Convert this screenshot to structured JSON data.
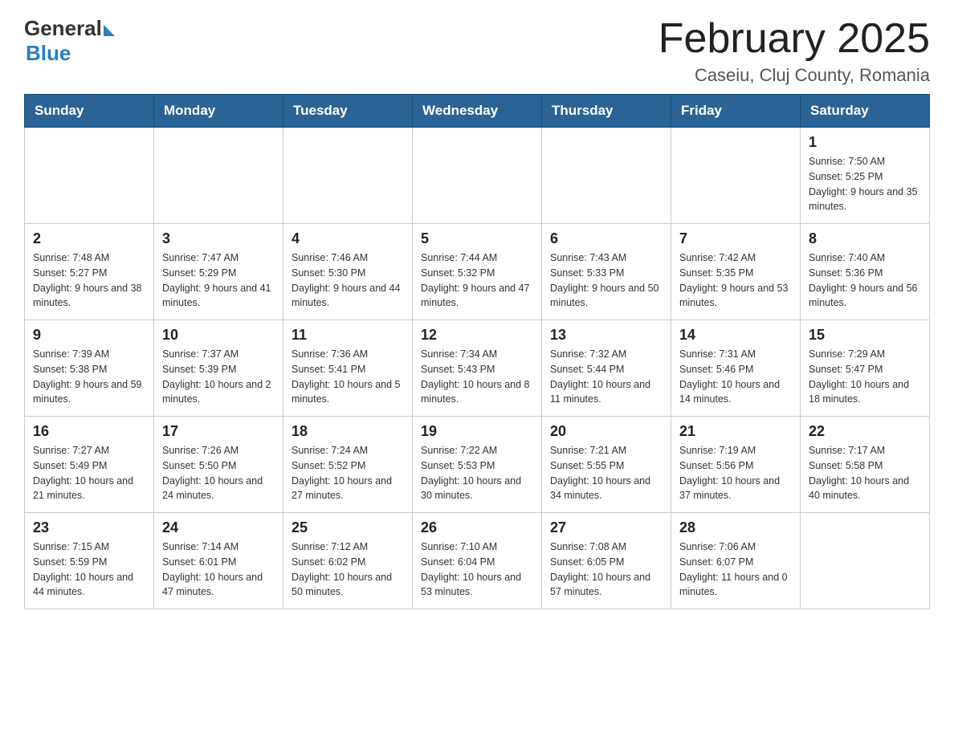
{
  "logo": {
    "general": "General",
    "blue": "Blue"
  },
  "header": {
    "title": "February 2025",
    "location": "Caseiu, Cluj County, Romania"
  },
  "days_of_week": [
    "Sunday",
    "Monday",
    "Tuesday",
    "Wednesday",
    "Thursday",
    "Friday",
    "Saturday"
  ],
  "weeks": [
    [
      {
        "day": "",
        "info": ""
      },
      {
        "day": "",
        "info": ""
      },
      {
        "day": "",
        "info": ""
      },
      {
        "day": "",
        "info": ""
      },
      {
        "day": "",
        "info": ""
      },
      {
        "day": "",
        "info": ""
      },
      {
        "day": "1",
        "info": "Sunrise: 7:50 AM\nSunset: 5:25 PM\nDaylight: 9 hours and 35 minutes."
      }
    ],
    [
      {
        "day": "2",
        "info": "Sunrise: 7:48 AM\nSunset: 5:27 PM\nDaylight: 9 hours and 38 minutes."
      },
      {
        "day": "3",
        "info": "Sunrise: 7:47 AM\nSunset: 5:29 PM\nDaylight: 9 hours and 41 minutes."
      },
      {
        "day": "4",
        "info": "Sunrise: 7:46 AM\nSunset: 5:30 PM\nDaylight: 9 hours and 44 minutes."
      },
      {
        "day": "5",
        "info": "Sunrise: 7:44 AM\nSunset: 5:32 PM\nDaylight: 9 hours and 47 minutes."
      },
      {
        "day": "6",
        "info": "Sunrise: 7:43 AM\nSunset: 5:33 PM\nDaylight: 9 hours and 50 minutes."
      },
      {
        "day": "7",
        "info": "Sunrise: 7:42 AM\nSunset: 5:35 PM\nDaylight: 9 hours and 53 minutes."
      },
      {
        "day": "8",
        "info": "Sunrise: 7:40 AM\nSunset: 5:36 PM\nDaylight: 9 hours and 56 minutes."
      }
    ],
    [
      {
        "day": "9",
        "info": "Sunrise: 7:39 AM\nSunset: 5:38 PM\nDaylight: 9 hours and 59 minutes."
      },
      {
        "day": "10",
        "info": "Sunrise: 7:37 AM\nSunset: 5:39 PM\nDaylight: 10 hours and 2 minutes."
      },
      {
        "day": "11",
        "info": "Sunrise: 7:36 AM\nSunset: 5:41 PM\nDaylight: 10 hours and 5 minutes."
      },
      {
        "day": "12",
        "info": "Sunrise: 7:34 AM\nSunset: 5:43 PM\nDaylight: 10 hours and 8 minutes."
      },
      {
        "day": "13",
        "info": "Sunrise: 7:32 AM\nSunset: 5:44 PM\nDaylight: 10 hours and 11 minutes."
      },
      {
        "day": "14",
        "info": "Sunrise: 7:31 AM\nSunset: 5:46 PM\nDaylight: 10 hours and 14 minutes."
      },
      {
        "day": "15",
        "info": "Sunrise: 7:29 AM\nSunset: 5:47 PM\nDaylight: 10 hours and 18 minutes."
      }
    ],
    [
      {
        "day": "16",
        "info": "Sunrise: 7:27 AM\nSunset: 5:49 PM\nDaylight: 10 hours and 21 minutes."
      },
      {
        "day": "17",
        "info": "Sunrise: 7:26 AM\nSunset: 5:50 PM\nDaylight: 10 hours and 24 minutes."
      },
      {
        "day": "18",
        "info": "Sunrise: 7:24 AM\nSunset: 5:52 PM\nDaylight: 10 hours and 27 minutes."
      },
      {
        "day": "19",
        "info": "Sunrise: 7:22 AM\nSunset: 5:53 PM\nDaylight: 10 hours and 30 minutes."
      },
      {
        "day": "20",
        "info": "Sunrise: 7:21 AM\nSunset: 5:55 PM\nDaylight: 10 hours and 34 minutes."
      },
      {
        "day": "21",
        "info": "Sunrise: 7:19 AM\nSunset: 5:56 PM\nDaylight: 10 hours and 37 minutes."
      },
      {
        "day": "22",
        "info": "Sunrise: 7:17 AM\nSunset: 5:58 PM\nDaylight: 10 hours and 40 minutes."
      }
    ],
    [
      {
        "day": "23",
        "info": "Sunrise: 7:15 AM\nSunset: 5:59 PM\nDaylight: 10 hours and 44 minutes."
      },
      {
        "day": "24",
        "info": "Sunrise: 7:14 AM\nSunset: 6:01 PM\nDaylight: 10 hours and 47 minutes."
      },
      {
        "day": "25",
        "info": "Sunrise: 7:12 AM\nSunset: 6:02 PM\nDaylight: 10 hours and 50 minutes."
      },
      {
        "day": "26",
        "info": "Sunrise: 7:10 AM\nSunset: 6:04 PM\nDaylight: 10 hours and 53 minutes."
      },
      {
        "day": "27",
        "info": "Sunrise: 7:08 AM\nSunset: 6:05 PM\nDaylight: 10 hours and 57 minutes."
      },
      {
        "day": "28",
        "info": "Sunrise: 7:06 AM\nSunset: 6:07 PM\nDaylight: 11 hours and 0 minutes."
      },
      {
        "day": "",
        "info": ""
      }
    ]
  ]
}
